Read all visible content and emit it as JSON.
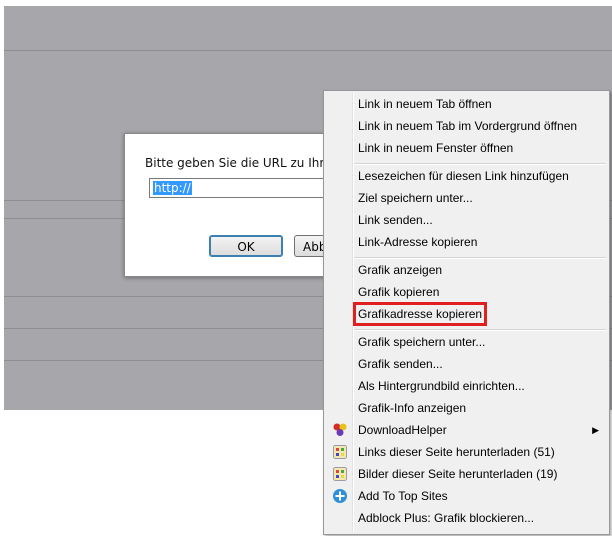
{
  "dialog": {
    "prompt": "Bitte geben Sie die URL zu Ihrer G",
    "url_value": "http://",
    "ok_label": "OK",
    "cancel_label": "Abb"
  },
  "context_menu": {
    "groups": [
      [
        "Link in neuem Tab öffnen",
        "Link in neuem Tab im Vordergrund öffnen",
        "Link in neuem Fenster öffnen"
      ],
      [
        "Lesezeichen für diesen Link hinzufügen",
        "Ziel speichern unter...",
        "Link senden...",
        "Link-Adresse kopieren"
      ],
      [
        "Grafik anzeigen",
        "Grafik kopieren",
        "Grafikadresse kopieren"
      ],
      [
        "Grafik speichern unter...",
        "Grafik senden...",
        "Als Hintergrundbild einrichten...",
        "Grafik-Info anzeigen"
      ]
    ],
    "extensions": [
      {
        "label": "DownloadHelper",
        "icon": "downloadhelper-icon",
        "has_submenu": true
      },
      {
        "label": "Links dieser Seite herunterladen (51)",
        "icon": "download-links-icon"
      },
      {
        "label": "Bilder dieser Seite herunterladen (19)",
        "icon": "download-images-icon"
      },
      {
        "label": "Add To Top Sites",
        "icon": "add-top-sites-icon"
      },
      {
        "label": "Adblock Plus: Grafik blockieren...",
        "icon": ""
      }
    ],
    "highlighted_item": "Grafikadresse kopieren",
    "highlight_color": "#e02020"
  }
}
